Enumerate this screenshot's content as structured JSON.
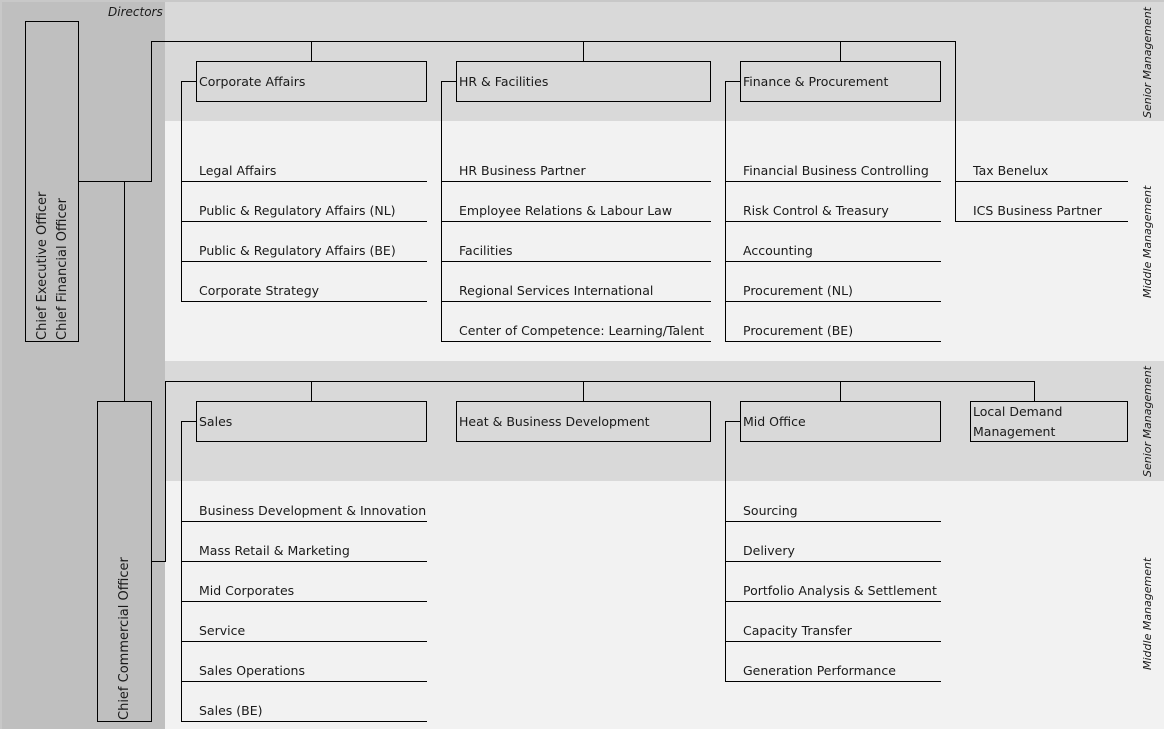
{
  "header": {
    "directors_label": "Directors"
  },
  "side_labels": {
    "senior_top": "Senior Management",
    "middle_top": "Middle Management",
    "senior_bottom": "Senior Management",
    "middle_bottom": "Middle Management"
  },
  "executives": {
    "ceo": "Chief Executive Officer",
    "cfo": "Chief Financial Officer",
    "cco": "Chief Commercial Officer"
  },
  "top_departments": [
    {
      "name": "Corporate Affairs",
      "units": [
        "Legal Affairs",
        "Public & Regulatory Affairs (NL)",
        "Public & Regulatory Affairs (BE)",
        "Corporate Strategy"
      ]
    },
    {
      "name": "HR & Facilities",
      "units": [
        "HR Business Partner",
        "Employee Relations & Labour Law",
        "Facilities",
        "Regional Services International",
        "Center of Competence: Learning/Talent"
      ]
    },
    {
      "name": "Finance & Procurement",
      "units": [
        "Financial Business Controlling",
        "Risk Control & Treasury",
        "Accounting",
        "Procurement (NL)",
        "Procurement (BE)"
      ]
    }
  ],
  "cfo_direct_units": [
    "Tax Benelux",
    "ICS Business Partner"
  ],
  "bottom_departments": [
    {
      "name": "Sales",
      "units": [
        "Business Development & Innovation",
        "Mass Retail & Marketing",
        "Mid Corporates",
        "Service",
        "Sales Operations",
        "Sales (BE)"
      ]
    },
    {
      "name": "Heat & Business Development",
      "units": []
    },
    {
      "name": "Mid Office",
      "units": [
        "Sourcing",
        "Delivery",
        "Portfolio Analysis & Settlement",
        "Capacity Transfer",
        "Generation Performance"
      ]
    },
    {
      "name": "Local Demand Management",
      "units": []
    }
  ],
  "colors": {
    "senior_band": "#d9d9d9",
    "middle_band": "#f2f2f2",
    "director_column": "#bfbfbf",
    "line": "#000000"
  }
}
